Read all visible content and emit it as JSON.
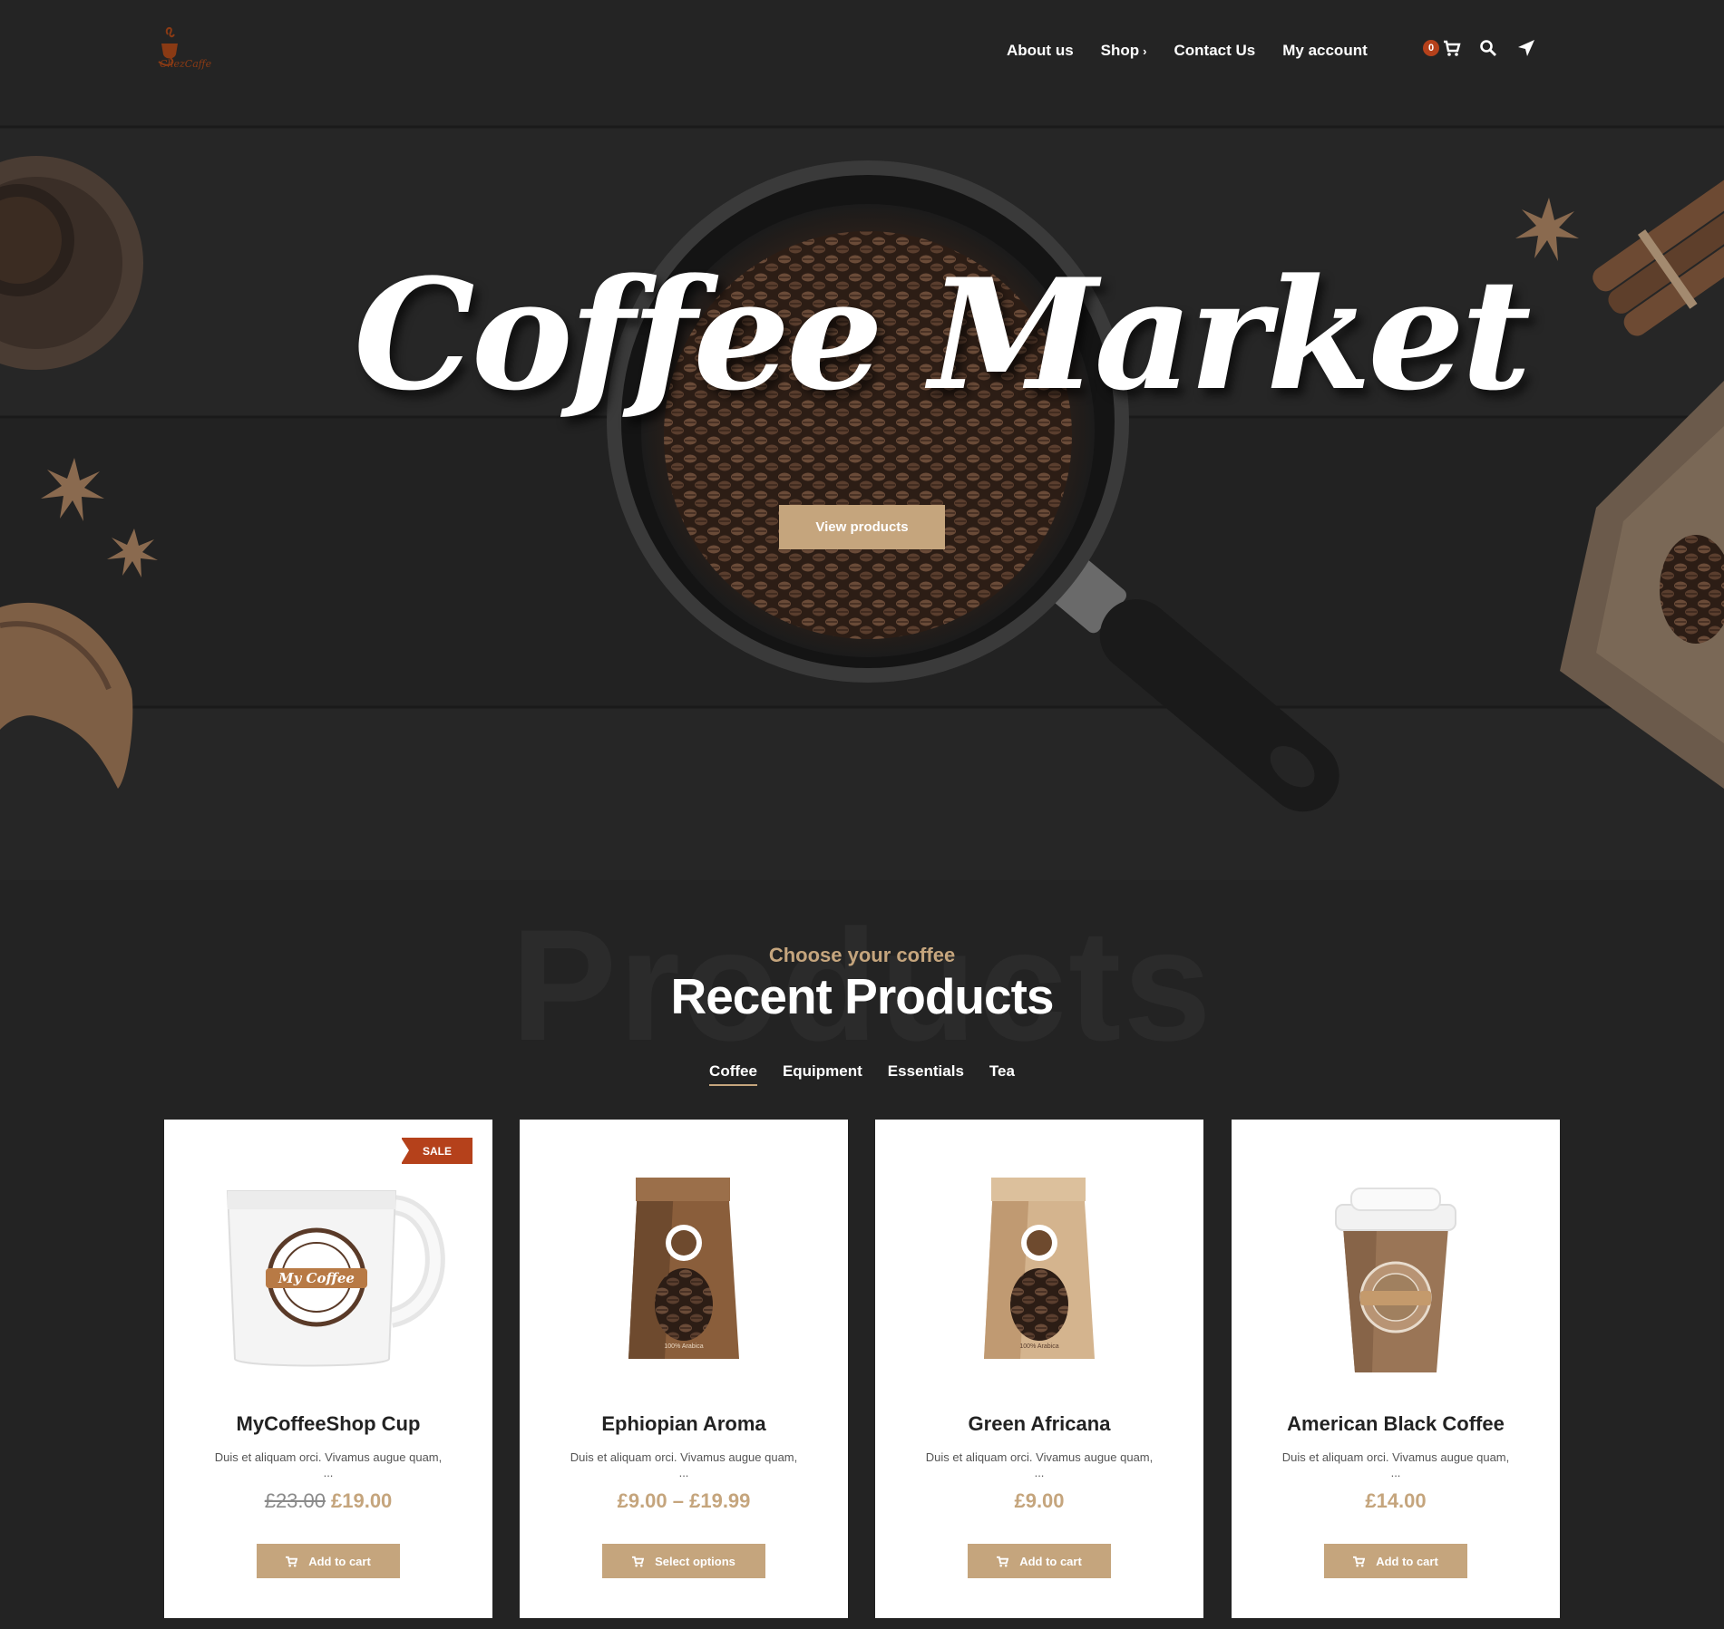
{
  "header": {
    "logo_text": "ChezCaffe",
    "nav": [
      {
        "label": "About us"
      },
      {
        "label": "Shop",
        "has_submenu": true
      },
      {
        "label": "Contact Us"
      },
      {
        "label": "My account"
      }
    ],
    "cart_count": "0",
    "icons": [
      "cart-icon",
      "search-icon",
      "location-arrow-icon"
    ]
  },
  "hero": {
    "title": "Coffee Market",
    "button_label": "View products"
  },
  "products_section": {
    "ghost_word": "Products",
    "subtitle": "Choose your coffee",
    "title": "Recent Products",
    "tabs": [
      {
        "label": "Coffee",
        "active": true
      },
      {
        "label": "Equipment",
        "active": false
      },
      {
        "label": "Essentials",
        "active": false
      },
      {
        "label": "Tea",
        "active": false
      }
    ],
    "products": [
      {
        "name": "MyCoffeeShop Cup",
        "description": "Duis et aliquam orci. Vivamus augue quam, ...",
        "old_price": "£23.00",
        "price": "£19.00",
        "badge": "SALE",
        "button_label": "Add to cart",
        "image": "white-mug"
      },
      {
        "name": "Ephiopian Aroma",
        "description": "Duis et aliquam orci. Vivamus augue quam, ...",
        "price": "£9.00 – £19.99",
        "button_label": "Select options",
        "image": "dark-coffee-bag"
      },
      {
        "name": "Green Africana",
        "description": "Duis et aliquam orci. Vivamus augue quam, ...",
        "price": "£9.00",
        "button_label": "Add to cart",
        "image": "light-coffee-bag"
      },
      {
        "name": "American Black Coffee",
        "description": "Duis et aliquam orci. Vivamus augue quam, ...",
        "price": "£14.00",
        "button_label": "Add to cart",
        "image": "paper-cup"
      }
    ],
    "product_image_labels": {
      "badge_text": "My Coffee",
      "bag_text_dark": "100% Arabica",
      "bag_text_light": "100% Arabica"
    }
  },
  "colors": {
    "accent": "#c5a57d",
    "sale": "#b5411b",
    "background": "#232323"
  }
}
